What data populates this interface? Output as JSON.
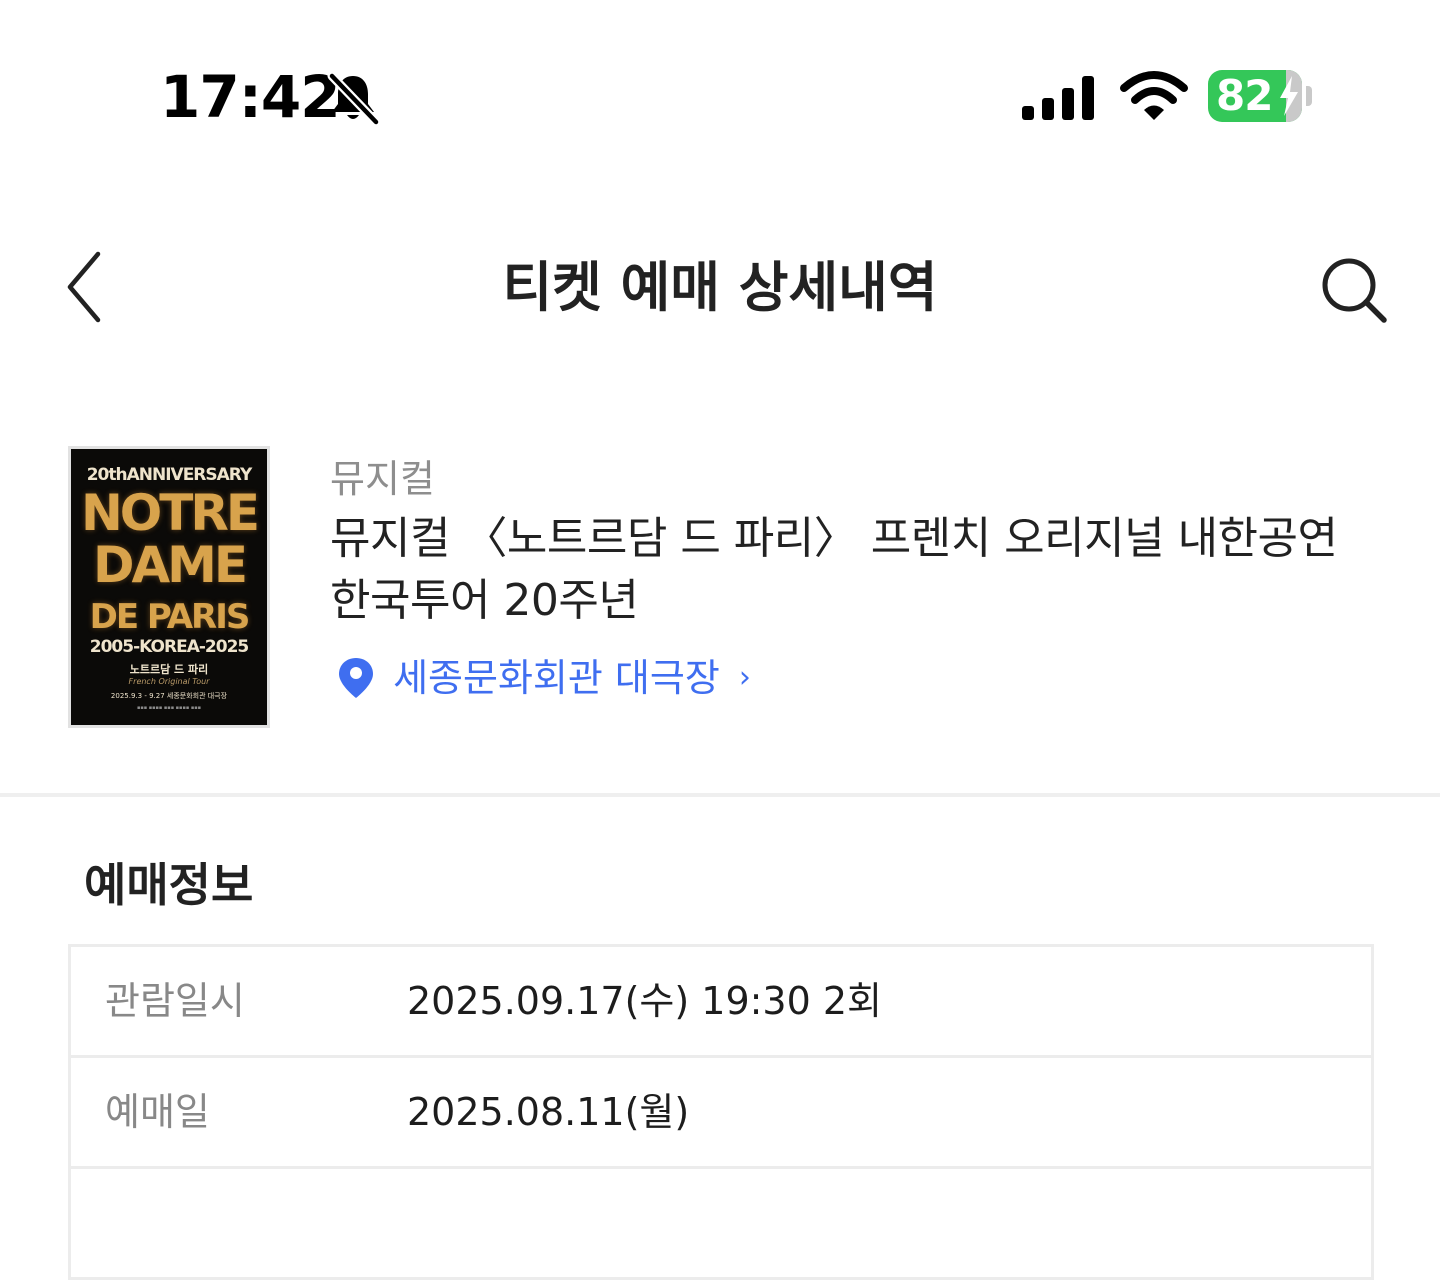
{
  "status_bar": {
    "time": "17:42",
    "battery_level": "82",
    "battery_color": "#34c759"
  },
  "header": {
    "title": "티켓 예매 상세내역",
    "back_icon": "chevron-left-icon",
    "search_icon": "search-icon"
  },
  "event": {
    "category": "뮤지컬",
    "title": "뮤지컬 〈노트르담 드 파리〉 프렌치 오리지널 내한공연 한국투어 20주년",
    "venue": "세종문화회관 대극장",
    "venue_chevron": "›",
    "accent_color": "#3f6ef0",
    "poster": {
      "anniversary": "20thANNIVERSARY",
      "line1": "NOTRE",
      "line2": "DAME",
      "line3": "DE PARIS",
      "years": "2005-KOREA-2025",
      "korean_title": "노트르담 드 파리",
      "tour": "French Original Tour",
      "dates": "2025.9.3 - 9.27 세종문화회관 대극장"
    }
  },
  "booking": {
    "heading": "예매정보",
    "rows": [
      {
        "label": "관람일시",
        "value": "2025.09.17(수) 19:30 2회"
      },
      {
        "label": "예매일",
        "value": "2025.08.11(월)"
      },
      {
        "label": "",
        "value": ""
      }
    ]
  }
}
